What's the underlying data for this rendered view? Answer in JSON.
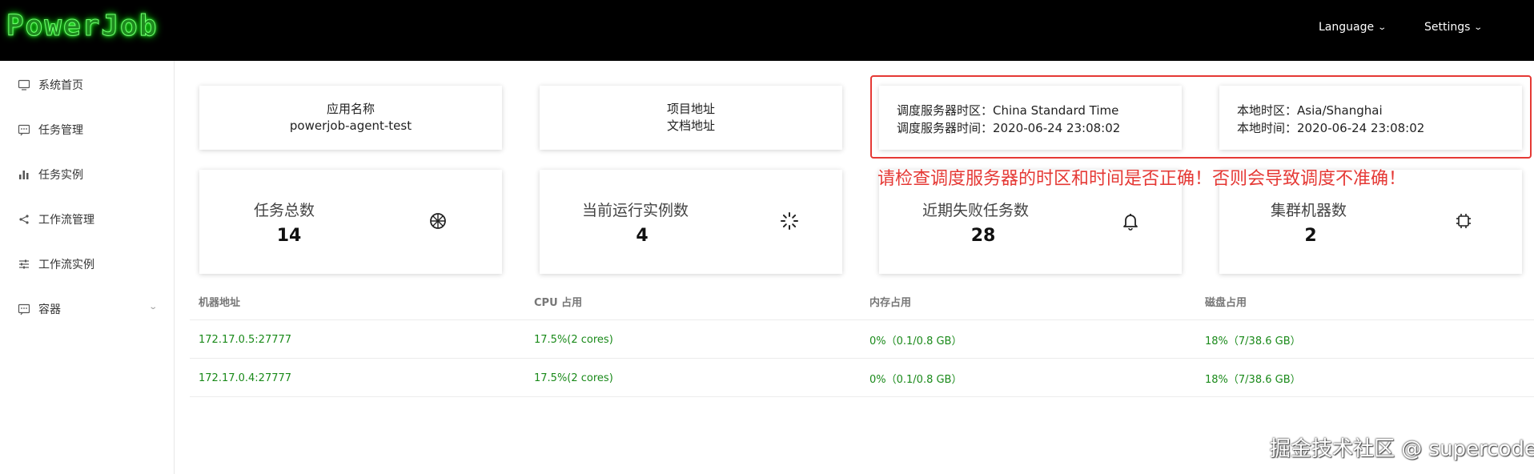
{
  "header": {
    "logo": "PowerJob",
    "language_label": "Language",
    "settings_label": "Settings"
  },
  "sidebar": {
    "items": [
      {
        "label": "系统首页",
        "icon": "desktop-icon"
      },
      {
        "label": "任务管理",
        "icon": "schedule-icon"
      },
      {
        "label": "任务实例",
        "icon": "bar-chart-icon"
      },
      {
        "label": "工作流管理",
        "icon": "share-icon"
      },
      {
        "label": "工作流实例",
        "icon": "sliders-icon"
      },
      {
        "label": "容器",
        "icon": "container-icon",
        "expandable": true
      }
    ]
  },
  "info": {
    "app_name_label": "应用名称",
    "app_name": "powerjob-agent-test",
    "project_address": "项目地址",
    "doc_address": "文档地址",
    "server_tz_label": "调度服务器时区：",
    "server_tz": "China Standard Time",
    "server_time_label": "调度服务器时间：",
    "server_time": "2020-06-24 23:08:02",
    "local_tz_label": "本地时区：",
    "local_tz": "Asia/Shanghai",
    "local_time_label": "本地时间：",
    "local_time": "2020-06-24 23:08:02"
  },
  "warning": "请检查调度服务器的时区和时间是否正确！否则会导致调度不准确！",
  "stats": [
    {
      "label": "任务总数",
      "value": "14",
      "icon": "dashboard-icon"
    },
    {
      "label": "当前运行实例数",
      "value": "4",
      "icon": "loading-icon"
    },
    {
      "label": "近期失败任务数",
      "value": "28",
      "icon": "bell-icon"
    },
    {
      "label": "集群机器数",
      "value": "2",
      "icon": "chip-icon"
    }
  ],
  "table": {
    "headers": [
      "机器地址",
      "CPU 占用",
      "内存占用",
      "磁盘占用"
    ],
    "rows": [
      [
        "172.17.0.5:27777",
        "17.5%(2 cores)",
        "0%（0.1/0.8 GB）",
        "18%（7/38.6 GB）"
      ],
      [
        "172.17.0.4:27777",
        "17.5%(2 cores)",
        "0%（0.1/0.8 GB）",
        "18%（7/38.6 GB）"
      ]
    ]
  },
  "watermark": "掘金技术社区 @ supercode",
  "colors": {
    "header_bg": "#000000",
    "logo_green": "#1f8a1f",
    "warning_red": "#e53935",
    "table_value_green": "#1a8a1a"
  }
}
